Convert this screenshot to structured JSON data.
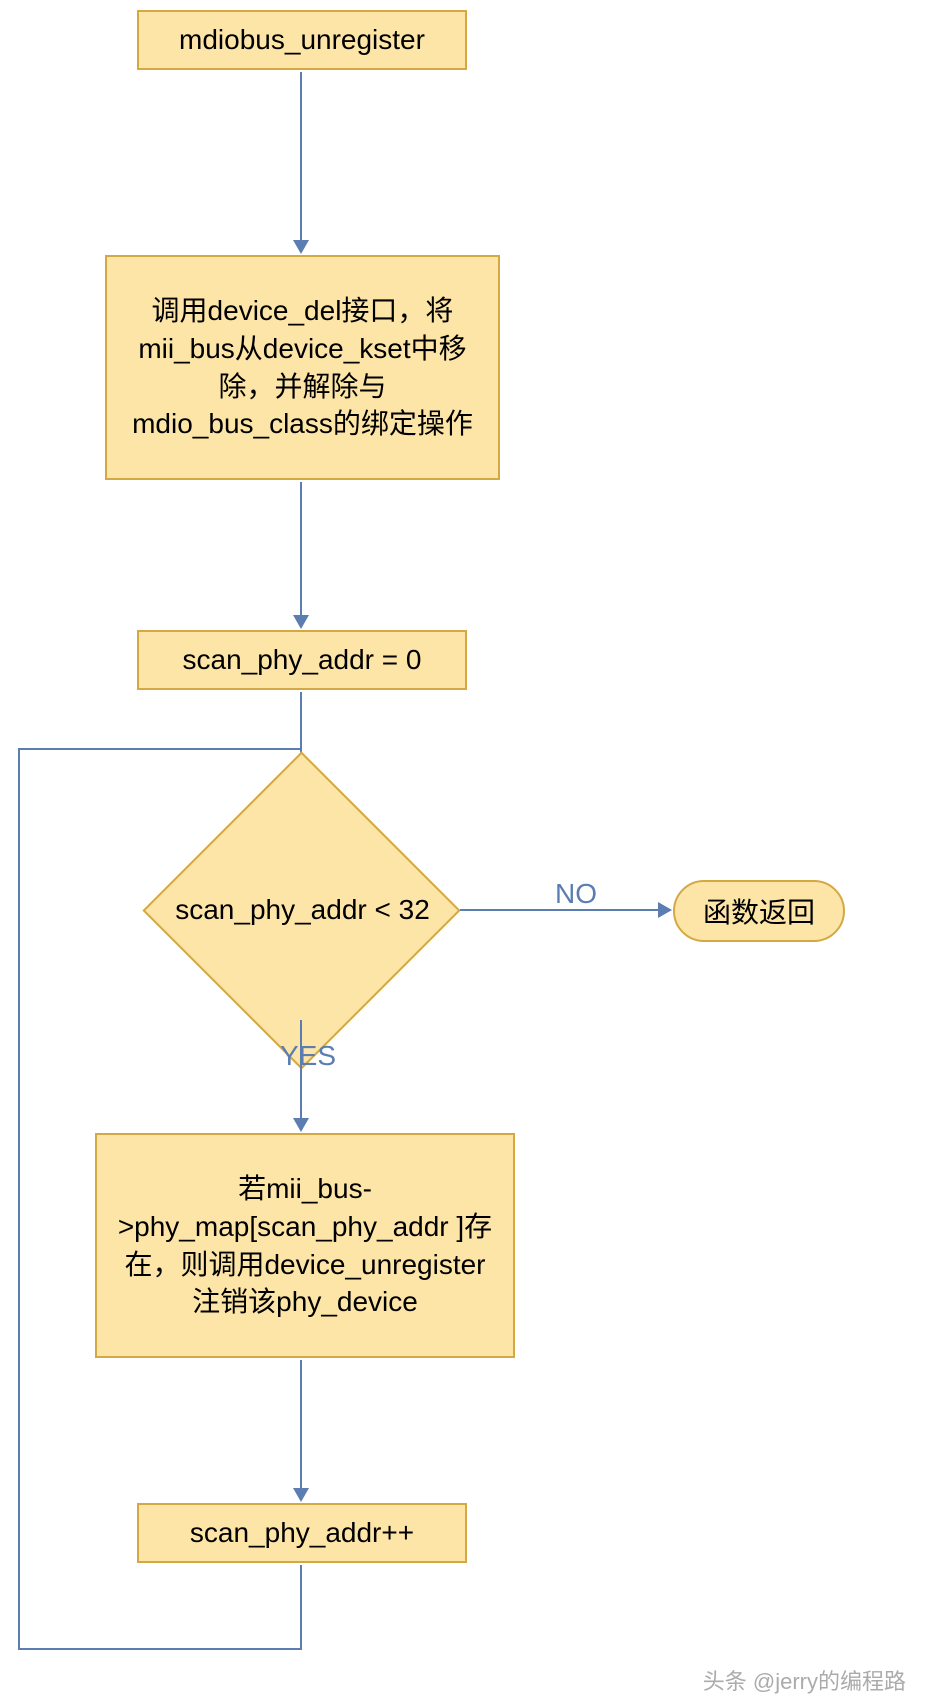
{
  "nodes": {
    "start": "mdiobus_unregister",
    "step1": "调用device_del接口，将mii_bus从device_kset中移除，并解除与mdio_bus_class的绑定操作",
    "step2": "scan_phy_addr = 0",
    "decision": "scan_phy_addr < 32",
    "return": "函数返回",
    "step3": "若mii_bus->phy_map[scan_phy_addr ]存在，则调用device_unregister注销该phy_device",
    "step4": "scan_phy_addr++"
  },
  "labels": {
    "yes": "YES",
    "no": "NO"
  },
  "watermark": "头条 @jerry的编程路"
}
